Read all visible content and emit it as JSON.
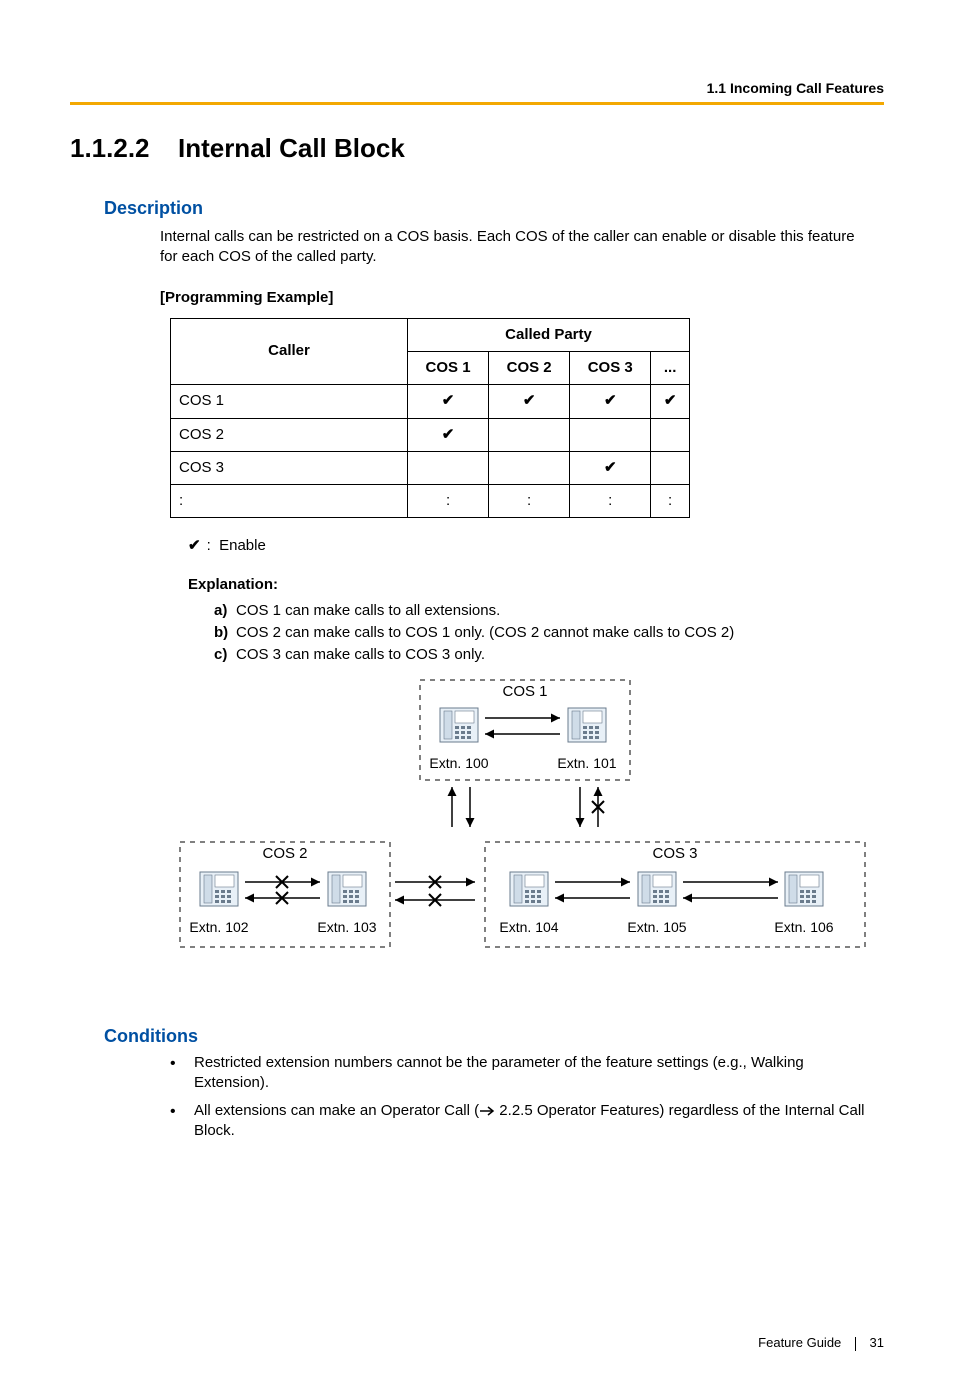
{
  "header": {
    "breadcrumb": "1.1 Incoming Call Features"
  },
  "section": {
    "number": "1.1.2.2",
    "title": "Internal Call Block"
  },
  "description": {
    "heading": "Description",
    "text": "Internal calls can be restricted on a COS basis. Each COS of the caller can enable or disable this feature for each COS of the called party.",
    "prog_example_label": "[Programming Example]"
  },
  "table": {
    "caller_header": "Caller",
    "called_party_header": "Called Party",
    "cols": [
      "COS 1",
      "COS 2",
      "COS 3",
      "..."
    ],
    "rows": [
      {
        "label": "COS 1",
        "cells": [
          "✔",
          "✔",
          "✔",
          "✔"
        ]
      },
      {
        "label": "COS 2",
        "cells": [
          "✔",
          "",
          "",
          ""
        ]
      },
      {
        "label": "COS 3",
        "cells": [
          "",
          "",
          "✔",
          ""
        ]
      },
      {
        "label": ":",
        "cells": [
          ":",
          ":",
          ":",
          ":"
        ]
      }
    ]
  },
  "enable": {
    "check": "✔",
    "colon": ":",
    "label": "Enable"
  },
  "explanation": {
    "heading": "Explanation:",
    "items": [
      {
        "marker": "a)",
        "text": "COS 1 can make calls to all extensions."
      },
      {
        "marker": "b)",
        "text": "COS 2 can make calls to COS 1 only. (COS 2 cannot make calls to COS 2)"
      },
      {
        "marker": "c)",
        "text": "COS 3 can make calls to COS 3 only."
      }
    ]
  },
  "diagram": {
    "cos1_label": "COS 1",
    "cos2_label": "COS 2",
    "cos3_label": "COS 3",
    "ext100": "Extn. 100",
    "ext101": "Extn. 101",
    "ext102": "Extn. 102",
    "ext103": "Extn. 103",
    "ext104": "Extn. 104",
    "ext105": "Extn. 105",
    "ext106": "Extn. 106"
  },
  "conditions": {
    "heading": "Conditions",
    "items": [
      {
        "text_pre": "Restricted extension numbers cannot be the parameter of the feature settings (e.g., Walking Extension).",
        "link": "",
        "text_post": ""
      },
      {
        "text_pre": "All extensions can make an Operator Call (",
        "link": " 2.2.5 Operator Features",
        "text_post": ") regardless of the Internal Call Block."
      }
    ]
  },
  "footer": {
    "guide": "Feature Guide",
    "page": "31"
  }
}
